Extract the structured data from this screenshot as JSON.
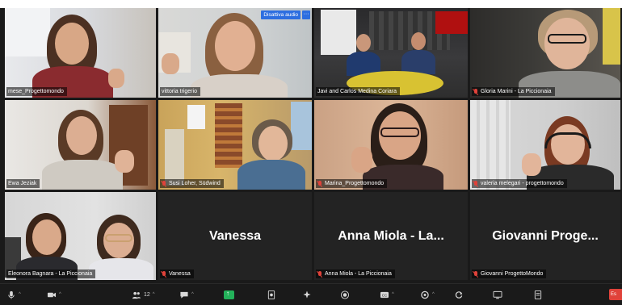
{
  "meeting": {
    "participants": [
      {
        "id": "p1",
        "label": "mese_Progettomondo",
        "muted": false
      },
      {
        "id": "p2",
        "label": "vittoria trigerio",
        "muted": false
      },
      {
        "id": "p3",
        "label": "Javi and Carlos Medina Coriara",
        "muted": false
      },
      {
        "id": "p4",
        "label": "Gloria Marini - La Piccionaia",
        "muted": true
      },
      {
        "id": "p5",
        "label": "Ewa Jeziak",
        "muted": false
      },
      {
        "id": "p6",
        "label": "Susi Loher, Südwind",
        "muted": true
      },
      {
        "id": "p7",
        "label": "Marina_Progettomondo",
        "muted": true
      },
      {
        "id": "p8",
        "label": "valeria melegari - progettomondo",
        "muted": true
      },
      {
        "id": "p9",
        "label": "Eleonora Bagnara - La Piccionaia",
        "muted": false
      },
      {
        "id": "p10",
        "label": "Vanessa",
        "display_name": "Vanessa",
        "muted": true
      },
      {
        "id": "p11",
        "label": "Anna Miola - La Piccionaia",
        "display_name": "Anna Miola - La...",
        "muted": true
      },
      {
        "id": "p12",
        "label": "Giovanni ProgettoMondo",
        "display_name": "Giovanni Proge...",
        "muted": true
      }
    ],
    "tile_controls": {
      "disable_audio_label": "Disattiva audio",
      "more_label": "···"
    }
  },
  "toolbar": {
    "participants_count": "12",
    "end_label": "Es"
  },
  "colors": {
    "speaking_outline": "#d7e84a",
    "accent_blue": "#2d6ee0",
    "share_green": "#23b25a",
    "muted_red": "#e0423a"
  }
}
